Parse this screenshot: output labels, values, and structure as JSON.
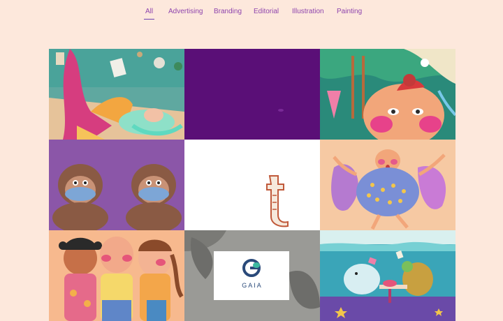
{
  "nav": {
    "items": [
      {
        "label": "All",
        "active": true
      },
      {
        "label": "Advertising",
        "active": false
      },
      {
        "label": "Branding",
        "active": false
      },
      {
        "label": "Editorial",
        "active": false
      },
      {
        "label": "Illustration",
        "active": false
      },
      {
        "label": "Painting",
        "active": false
      }
    ]
  },
  "gallery": {
    "tiles": [
      {
        "subject": "girl-reading-room-illustration"
      },
      {
        "subject": "purple-solid-tile"
      },
      {
        "subject": "jungle-woman-face-illustration"
      },
      {
        "subject": "monkeys-with-masks-illustration"
      },
      {
        "subject": "letter-t-lettering"
      },
      {
        "subject": "dancing-woman-illustration"
      },
      {
        "subject": "three-kids-illustration"
      },
      {
        "subject": "gaia-logo-mockup",
        "logo_text": "GAIA"
      },
      {
        "subject": "underwater-manatee-turtle-illustration"
      }
    ]
  },
  "colors": {
    "background": "#fde8dc",
    "nav_text": "#8e44ad",
    "purple_tile": "#5a0f77"
  }
}
